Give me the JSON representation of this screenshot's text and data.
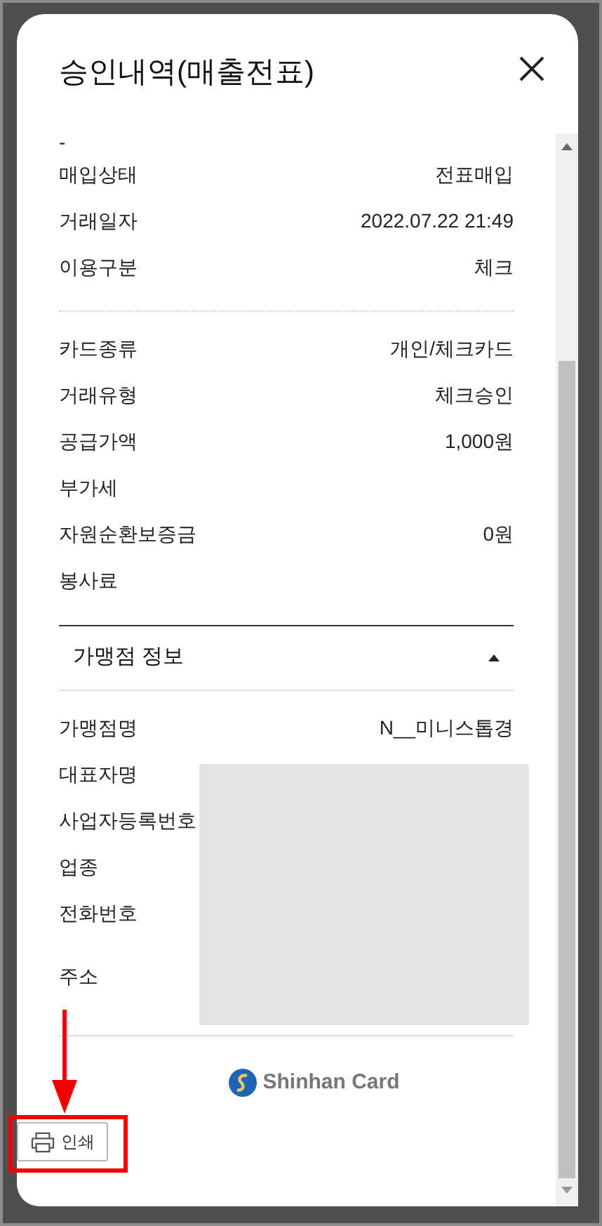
{
  "dialog": {
    "title": "승인내역(매출전표)"
  },
  "sections": [
    {
      "kind": "plain",
      "rows": [
        {
          "label": "-"
        },
        {
          "label": "매입상태",
          "value": "전표매입"
        },
        {
          "label": "거래일자",
          "value": "2022.07.22 21:49"
        },
        {
          "label": "이용구분",
          "value": "체크"
        }
      ]
    },
    {
      "kind": "plain",
      "rows": [
        {
          "label": "카드종류",
          "value": "개인/체크카드"
        },
        {
          "label": "거래유형",
          "value": "체크승인"
        },
        {
          "label": "공급가액",
          "value": "1,000원"
        },
        {
          "label": "부가세"
        },
        {
          "label": "자원순환보증금",
          "value": "0원"
        },
        {
          "label": "봉사료"
        }
      ]
    },
    {
      "kind": "collapsible",
      "title": "가맹점 정보",
      "expanded": true,
      "redacted": true,
      "rows": [
        {
          "label": "가맹점명",
          "value": "N__미니스톱경"
        },
        {
          "label": "대표자명"
        },
        {
          "label": "사업자등록번호"
        },
        {
          "label": "업종"
        },
        {
          "label": "전화번호"
        },
        {
          "label": "주소",
          "tall": true
        }
      ]
    }
  ],
  "logo_text": "Shinhan Card",
  "print_button": {
    "label": "인쇄"
  }
}
